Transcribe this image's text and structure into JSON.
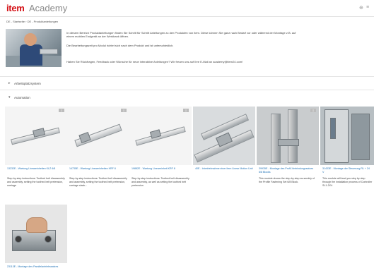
{
  "header": {
    "logo": "item",
    "logo_sub": "Academy",
    "icons": [
      "search-icon",
      "menu-icon"
    ]
  },
  "breadcrumb": {
    "text": "DE - Startseite  ›  DE - Produktanleitungen"
  },
  "intro": {
    "p1": "In diesem Bereich Produktanleitungen finden Sie Schritt für Schritt Anleitungen zu den Produkten von item. Diese können Sie ganz nach Bedarf vor oder während der Montage z.B. auf einem mobilen Endgerät an der Werkbank öffnen.",
    "p2": "Die Bearbeitungszeit pro Modul richtet sich nach dem Produkt und ist unterschiedlich.",
    "p3": "Haben Sie Rückfragen, Feedback oder Wünsche für neue interaktive Anleitungen? Wir freuen uns auf Ihre E-Mail an academy@item24.com!"
  },
  "sections": [
    {
      "label": "Arbeitsplatzsystem",
      "chevron": "▸"
    },
    {
      "label": "Automation",
      "chevron": "▾"
    }
  ],
  "cards": [
    {
      "title": "13232E - Wartung Lineareinheiten KLZ 6/8",
      "desc": "Step-by-step instructions: Toothed belt disassembly and assembly, setting the toothed belt pretension, carriage",
      "badge": "⇩"
    },
    {
      "title": "14735E - Wartung Lineareinheiten KRF 8",
      "desc": "Step-by-step instructions: Toothed belt disassembly and assembly, setting the toothed belt pretension, carriage slack...",
      "badge": "⇩"
    },
    {
      "title": "19882E - Wartung Lineareinheit KRF 8",
      "desc": "Step-by-step instructions: Toothed belt disassembly and assembly, as well as setting the toothed belt pretension",
      "badge": "⇩"
    },
    {
      "title": "40E - Inbetriebnahme einer item Linear Motion Unit",
      "desc": "",
      "badge": ""
    },
    {
      "title": "39935E - Montage des Profil-Verbindungssatzes 6/8 Blocks",
      "desc": "This module shows the step-by-step as-sembly of the Profile Fastening Set 6/8 Block.",
      "badge": "⇩"
    },
    {
      "title": "31433E - Montage der Steuerung RL + 24 V",
      "desc": "This module will lead you step by step through the installation process of Controller SL1-24V.",
      "badge": ""
    },
    {
      "title": "23113E - Montage des Parallelantriebssatzes",
      "desc": "",
      "badge": ""
    }
  ]
}
